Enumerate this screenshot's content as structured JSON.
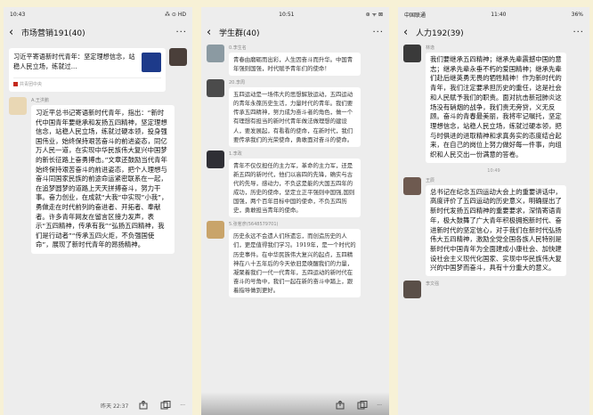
{
  "panel1": {
    "status": {
      "time": "10:43",
      "signal": "⁂ ⊙ HD"
    },
    "title": "市场营销191(40)",
    "back_icon": "‹",
    "more_icon": "···",
    "card": {
      "title": "习近平寄语新时代青年：坚定理想信念，站稳人民立场，练就过...",
      "source": "共青团中央"
    },
    "message": {
      "sender": "A.王洪鹏",
      "text": "习近平总书记寄语新时代青年，指出：“新时代中国青年要继承和发扬五四精神，坚定理想信念，站稳人民立场，练就过硬本领，投身强国伟业，始终保持艰苦奋斗的前进姿态，同亿万人民一道，在实现中华民族伟大复兴中国梦的新长征路上奋勇搏击。”文章还鼓励当代青年始终保持艰苦奋斗的前进姿态，把个人理想与奋斗同国家民族的前途命运紧密联系在一起，在追梦圆梦的道路上天天拼搏奋斗，努力干事。奋力创业，在成就“大我“中实现”小我”，勇做走在时代前列的奋进者、开拓者、奉献者。许多青年网友在留言区接力发声，表示“五四精神，传承有我”“弘扬五四精神，我们是行动者”“传承五四火炬，不负强国使命”，展现了新时代青年的昂扬精神。"
    },
    "bottom": {
      "time": "昨天 22:37"
    }
  },
  "panel2": {
    "status": {
      "time": "10:51",
      "right": "⊛ ᯤ ⊠"
    },
    "title": "学生群(40)",
    "back_icon": "‹",
    "more_icon": "···",
    "messages": [
      {
        "sender": "0.李生名",
        "text": "青春由磨砺而出彩，人生因奋斗而升华。中国青年强则国强，时代赋予青年们的使命！"
      },
      {
        "sender": "20.李周",
        "text": "五四运动是一场伟大的思想解放运动，五四运动的青年永葆历史生活，力量时代的青年。我们要传承五四精神，努力成为奋斗者的角色，做一个有理想有担当的新时代青年做法做理想的建设人，要发展起，有看看的使命，在新时代，我们要传承我们的光荣使命，勇敢面对奋斗的使命。"
      },
      {
        "sender": "1.李政",
        "text": "青年不仅仅担任的主力军，革命的主力军，还是新五四的新时代，他们以高四的先锋，确实与古代的先导，感动力，不负这是能的大国五四年的成功，历史的使命，坚定立正平强则中国强,国则国强，两个百年目标中国的使命，不负五四历史，勇敢担当青年的使命。"
      },
      {
        "sender": "5.张茗彦(5648579701)",
        "text": "历史永远不会遗人们所遗忘，而创造历史的人们，更是值得我们学习。1919年，是一个时代的历史事件。在中华民族伟大复兴的起点，五四精神在八十五年后的今天依旧是唤醒我们的力量，凝聚着我们一代一代青年，五四运动的新时代在奋斗的号角中，我们一起在新的奋斗中踏上，跟着指导做到更好。"
      }
    ]
  },
  "panel3": {
    "status": {
      "time": "11:40",
      "carrier": "中国联通",
      "battery": "36%"
    },
    "title": "人力192(39)",
    "back_icon": "‹",
    "more_icon": "···",
    "messages": [
      {
        "sender": "林逸",
        "text": "我们要继承五四精神；继承先辈震撼中国的意志；继承先辈永垂不朽的爱国精神；继承先辈们赴后继英勇无畏的牺牲精神！作为新时代的青年，我们注定要承担历史的重任，这是社会和人民赋予我们的职责。面对抗击新冠肺炎这场没有硝烟的战争，我们责无旁贷，义无反顾。奋斗的青春最美丽，我将牢记嘱托，坚定理想信念，站稳人民立场，练就过硬本领，把与时俱进的进取精神和求真务实的态度结合起来，在自己的岗位上努力做好每一件事，向组织和人民交出一份满意的答卷。"
      },
      {
        "sender": "王辰",
        "text": "总书记在纪念五四运动大会上的重要讲话中，高度评价了五四运动的历史意义，明确提出了新时代发扬五四精神的重要要求，深情寄语青年，极大鼓舞了广大青年积极拥抱新时代、奋进新时代的坚定信心，对于我们在新时代弘扬伟大五四精神，激励全党全国各族人民特别是新时代中国青年为全面建成小康社会、加快建设社会主义现代化国家、实现中华民族伟大复兴的中国梦而奋斗，具有十分重大的意义。"
      }
    ],
    "time_divider": "10:49",
    "bottom_sender": "李文强"
  }
}
